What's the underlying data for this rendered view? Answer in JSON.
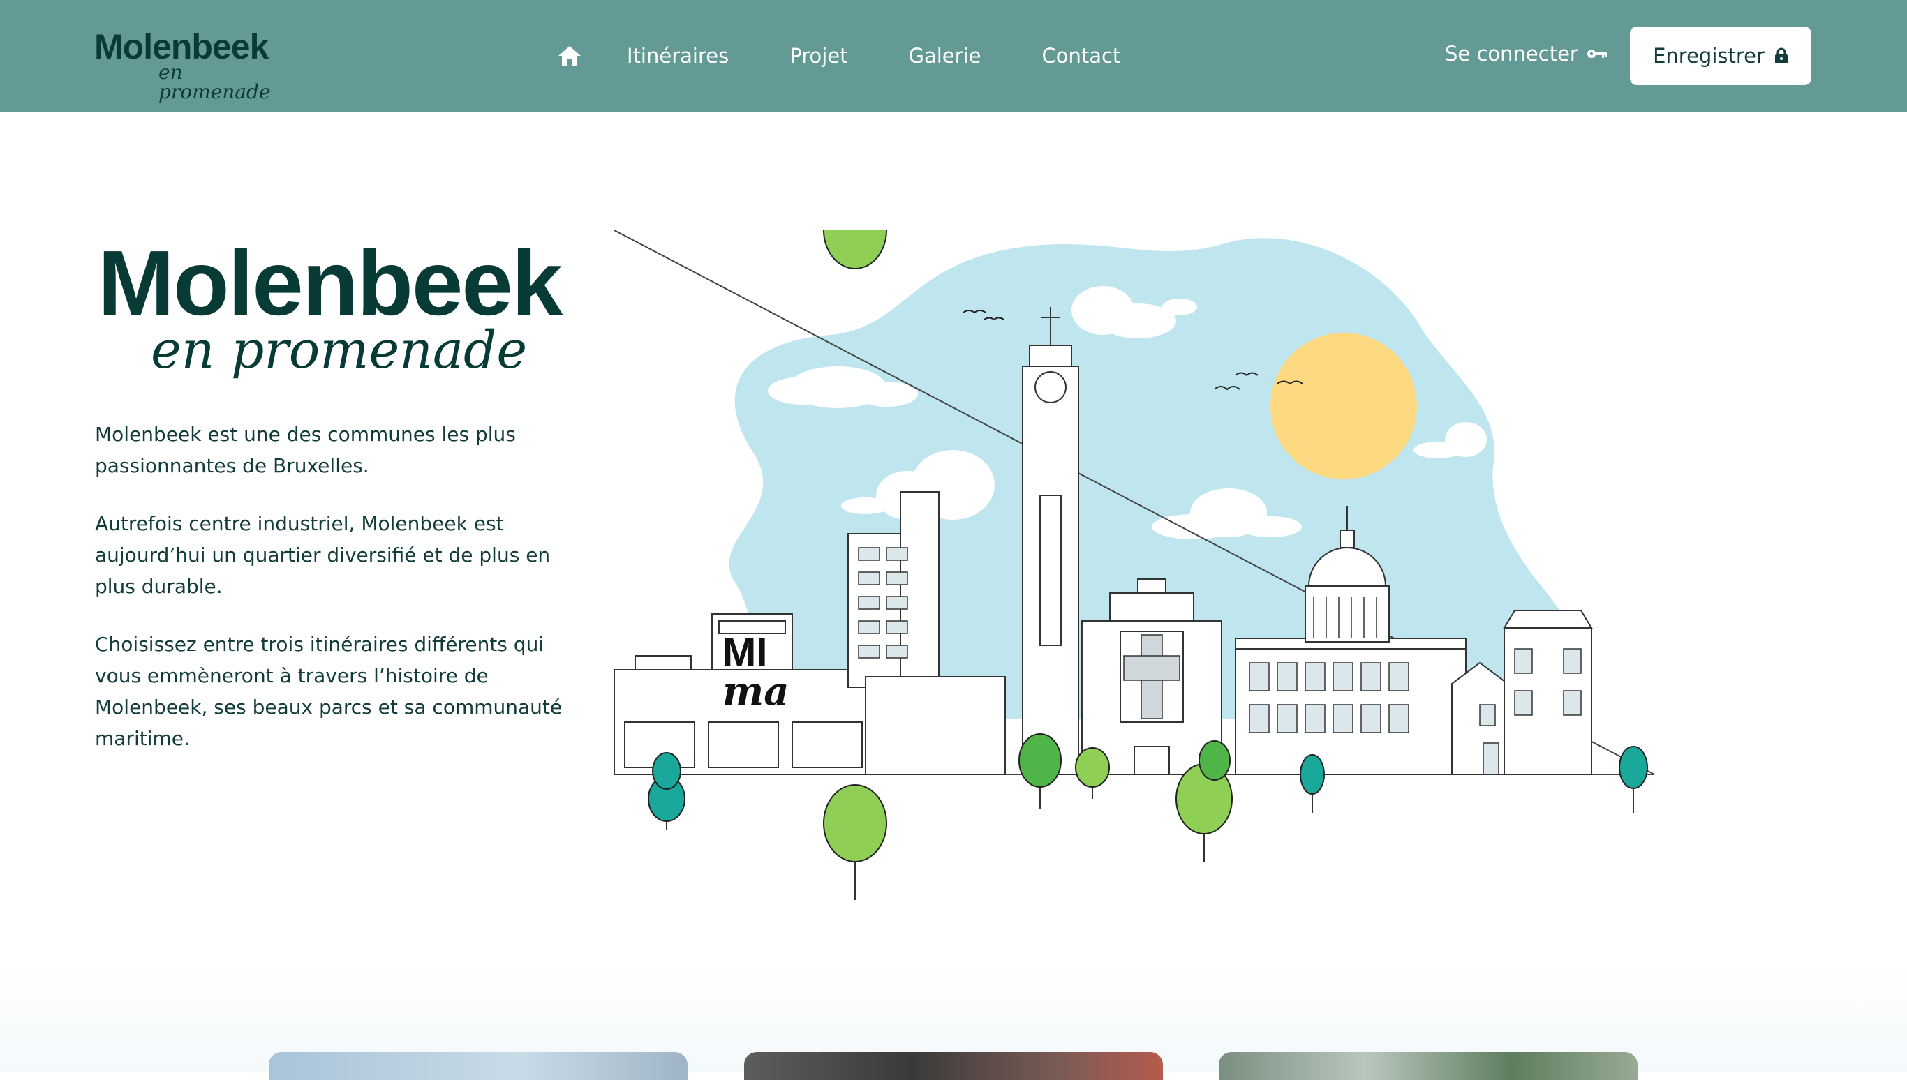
{
  "header": {
    "logo": {
      "word": "Molenbeek",
      "script": "en promenade"
    },
    "nav": [
      {
        "label": "Itinéraires"
      },
      {
        "label": "Projet"
      },
      {
        "label": "Galerie"
      },
      {
        "label": "Contact"
      }
    ],
    "login_label": "Se connecter",
    "register_label": "Enregistrer",
    "icons": {
      "home": "home-icon",
      "login": "key-icon",
      "register": "lock-icon"
    }
  },
  "hero": {
    "logo": {
      "word": "Molenbeek",
      "script": "en promenade"
    },
    "paragraphs": [
      "Molenbeek est une des communes les plus passionnantes de Bruxelles.",
      "Autrefois centre industriel, Molenbeek est aujourd’hui un quartier diversifié et de plus en plus durable.",
      "Choisissez entre trois itinéraires différents qui vous emmèneront à travers l’histoire de Molenbeek, ses beaux parcs et sa communauté maritime."
    ],
    "illustration": {
      "sign_line1": "MI",
      "sign_line2": "ma"
    }
  },
  "colors": {
    "header_bg": "#649a96",
    "brand_dark": "#083a36",
    "sky": "#bfe6ee",
    "sun": "#fdd982",
    "tree_light": "#8fcf55",
    "tree_teal": "#1aa89a"
  }
}
